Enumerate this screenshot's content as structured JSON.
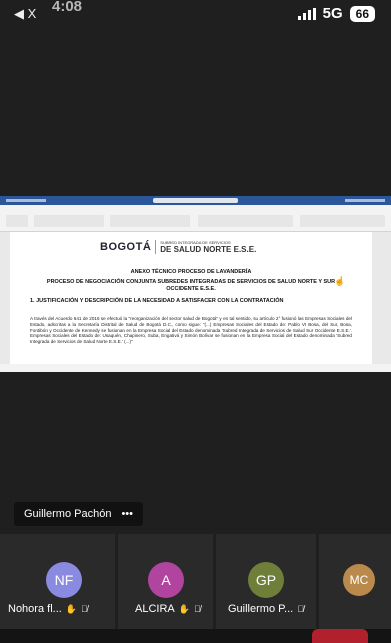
{
  "status_bar": {
    "back_label": "◀ X",
    "time": "4:08",
    "network": "5G",
    "battery": "66"
  },
  "document": {
    "logo_main": "BOGOTÁ",
    "logo_sub_line1": "SUBRED INTEGRADA DE SERVICIOS",
    "logo_sub_line2": "DE SALUD NORTE E.S.E.",
    "heading": "ANEXO TÉCNICO PROCESO DE LAVANDERÍA",
    "subheading": "PROCESO DE NEGOCIACIÓN CONJUNTA SUBREDES INTEGRADAS DE SERVICIOS DE SALUD NORTE Y SUR OCCIDENTE E.S.E.",
    "section_title": "1. JUSTIFICACIÓN Y DESCRIPCIÓN DE LA NECESIDAD A SATISFACER CON LA CONTRATACIÓN",
    "body": "A través del Acuerdo 641 de 2016 se efectuó la \"reorganización del sector salud de Bogotá\" y en tal sentido, su artículo 2° fusionó las Empresas Sociales del Estado, adscritas a la Secretaría Distrital de Salud de Bogotá D.C., como sigue: \"(...) Empresas Sociales del Estado de: Pablo VI Bosa, del Sur, Bosa, Fontibón y Occidente de Kennedy se fusionan en la Empresa Social del Estado denominada 'Subred Integrada de Servicios de Salud Sur Occidente E.S.E.'. Empresas Sociales del Estado de: Usaquén, Chapinero, Suba, Engativá y Simón Bolívar se fusionan en la Empresa Social del Estado denominada 'Subred Integrada de Servicios de Salud Norte E.S.E.' (...)\""
  },
  "presenter": {
    "name": "Guillermo Pachón",
    "more": "•••"
  },
  "participants": [
    {
      "initials": "NF",
      "name": "Nohora fl...",
      "color": "#8a8ae0"
    },
    {
      "initials": "A",
      "name": "ALCIRA",
      "color": "#b0449e"
    },
    {
      "initials": "GP",
      "name": "Guillermo P...",
      "color": "#6f7f3a"
    },
    {
      "initials": "MC",
      "name": "",
      "color": "#b98a4c"
    }
  ],
  "colors": {
    "background": "#1f1f1f",
    "word_blue": "#2b579a",
    "leave_red": "#b3202d"
  },
  "icons": {
    "hand": "hand-raised-icon",
    "mic": "mic-muted-icon"
  }
}
